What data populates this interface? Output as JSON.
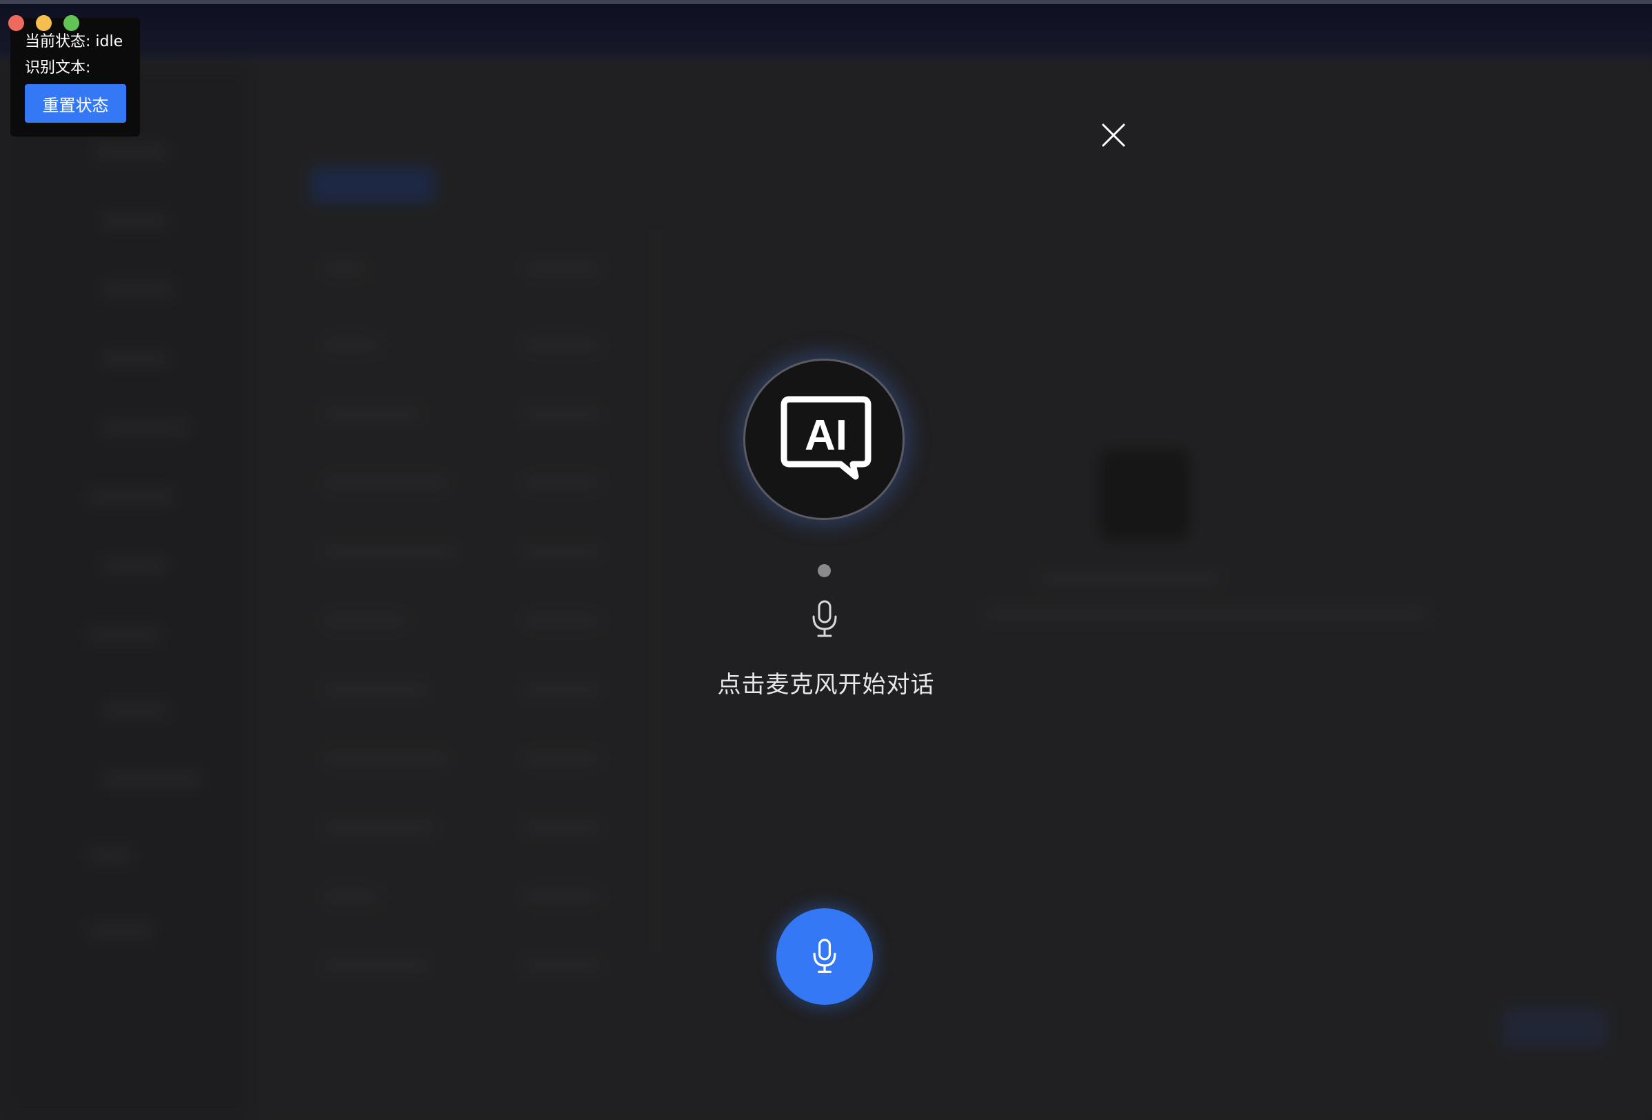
{
  "debug": {
    "state_label": "当前状态: idle",
    "recognized_label": "识别文本:",
    "reset_label": "重置状态"
  },
  "voice": {
    "avatar_text": "AI",
    "hint": "点击麦克风开始对话"
  },
  "icons": {
    "close": "close-icon",
    "mic": "microphone-icon",
    "ai": "ai-chat-bubble-icon"
  },
  "colors": {
    "accent": "#3478f6",
    "background": "#262627",
    "traffic_red": "#ed6a5e",
    "traffic_yellow": "#f5bf4f",
    "traffic_green": "#61c454"
  }
}
